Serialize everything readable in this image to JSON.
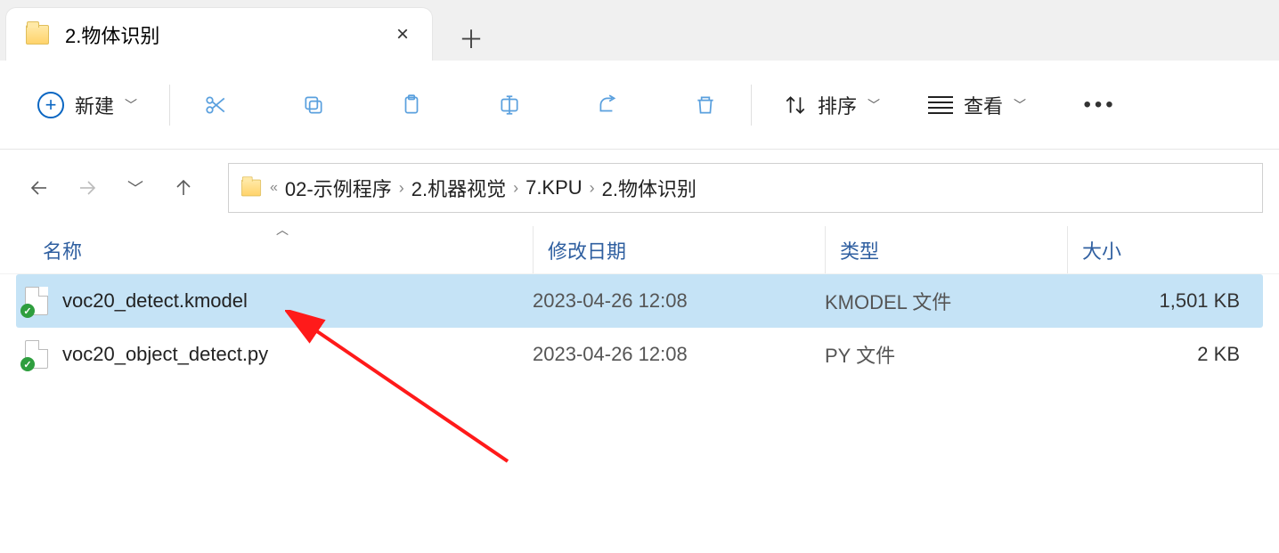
{
  "tab": {
    "title": "2.物体识别"
  },
  "toolbar": {
    "new_label": "新建",
    "sort_label": "排序",
    "view_label": "查看"
  },
  "breadcrumb": {
    "items": [
      "02-示例程序",
      "2.机器视觉",
      "7.KPU",
      "2.物体识别"
    ]
  },
  "columns": {
    "name": "名称",
    "date": "修改日期",
    "type": "类型",
    "size": "大小"
  },
  "files": [
    {
      "name": "voc20_detect.kmodel",
      "date": "2023-04-26 12:08",
      "type": "KMODEL 文件",
      "size": "1,501 KB",
      "selected": true
    },
    {
      "name": "voc20_object_detect.py",
      "date": "2023-04-26 12:08",
      "type": "PY 文件",
      "size": "2 KB",
      "selected": false
    }
  ]
}
